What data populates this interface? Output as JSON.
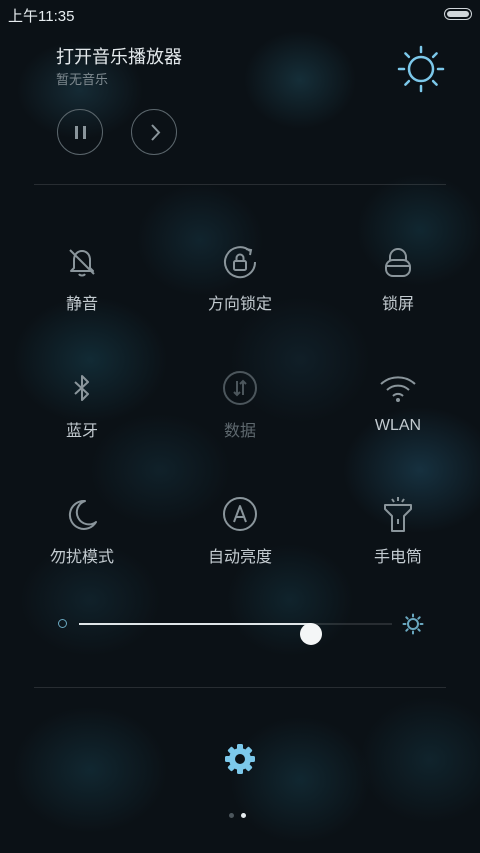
{
  "status_bar": {
    "time": "上午11:35",
    "battery_icon": "battery-icon"
  },
  "music": {
    "title": "打开音乐播放器",
    "subtitle": "暂无音乐",
    "pause_icon": "pause-icon",
    "next_icon": "next-icon"
  },
  "header": {
    "brightness_icon": "sun-icon"
  },
  "toggles": [
    {
      "label": "静音",
      "icon": "bell-off-icon",
      "active": false
    },
    {
      "label": "方向锁定",
      "icon": "rotation-lock-icon",
      "active": false
    },
    {
      "label": "锁屏",
      "icon": "lock-icon",
      "active": false
    },
    {
      "label": "蓝牙",
      "icon": "bluetooth-icon",
      "active": false
    },
    {
      "label": "数据",
      "icon": "mobile-data-icon",
      "active": false,
      "disabled": true
    },
    {
      "label": "WLAN",
      "icon": "wifi-icon",
      "active": false
    },
    {
      "label": "勿扰模式",
      "icon": "moon-icon",
      "active": false
    },
    {
      "label": "自动亮度",
      "icon": "auto-brightness-icon",
      "active": false
    },
    {
      "label": "手电筒",
      "icon": "flashlight-icon",
      "active": false
    }
  ],
  "brightness": {
    "level": 0.74,
    "low_icon": "brightness-low-icon",
    "high_icon": "brightness-high-icon"
  },
  "footer": {
    "settings_icon": "gear-icon",
    "page_count": 2,
    "current_page": 2
  },
  "colors": {
    "accent": "#6fb8d8",
    "text": "#c3cbd0",
    "dim_text": "#5e686e",
    "background": "#0b1116"
  }
}
